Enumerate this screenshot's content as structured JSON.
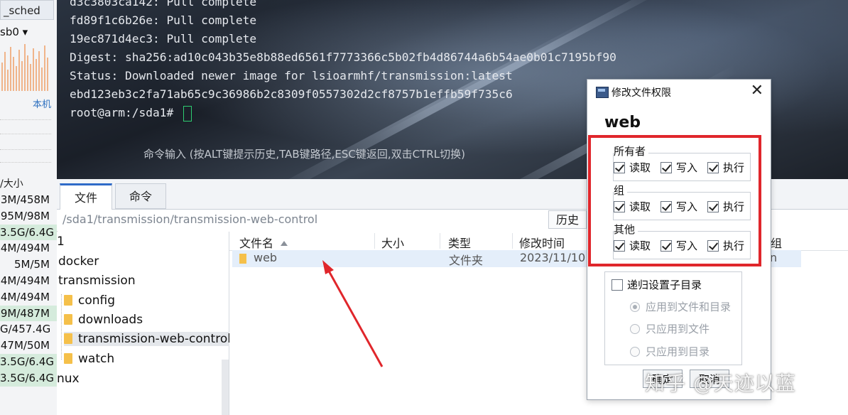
{
  "left_panel": {
    "sched_label": "_sched",
    "iface": "sb0",
    "local_label": "本机",
    "size_header": "/大小",
    "sizes": [
      "3M/458M",
      "95M/98M",
      "3.5G/6.4G",
      "4M/494M",
      "5M/5M",
      "4M/494M",
      "4M/494M",
      "9M/487M",
      "G/457.4G",
      "47M/50M",
      "3.5G/6.4G",
      "3.5G/6.4G"
    ]
  },
  "terminal": {
    "lines": [
      "d3c3803ca142: Pull complete",
      "fd89f1c6b26e: Pull complete",
      "19ec871d4ec3: Pull complete",
      "Digest: sha256:ad10c043b35e8b88ed6561f7773366c5b02fb4d86744a6b54ae0b01c7195bf90",
      "Status: Downloaded newer image for lsioarmhf/transmission:latest",
      "ebd123eb3c2fa71ab65c9c36986b2c8309f0557302d2cf8757b1effb59f735c6",
      "root@arm:/sda1# "
    ],
    "hint": "命令输入 (按ALT键提示历史,TAB键路径,ESC键返回,双击CTRL切换)"
  },
  "tabs": {
    "files": "文件",
    "commands": "命令"
  },
  "path": {
    "value": "/sda1/transmission/transmission-web-control",
    "history_button": "历史"
  },
  "tree": {
    "nodes": [
      "1",
      "docker",
      "transmission",
      "config",
      "downloads",
      "transmission-web-control",
      "watch",
      "nux"
    ]
  },
  "file_list": {
    "columns": {
      "name": "文件名",
      "size": "大小",
      "type": "类型",
      "modified": "修改时间",
      "group": "组"
    },
    "rows": [
      {
        "name": "web",
        "type": "文件夹",
        "modified": "2023/11/10",
        "tail": "n"
      }
    ]
  },
  "dialog": {
    "title": "修改文件权限",
    "name": "web",
    "groups": [
      {
        "label": "所有者",
        "read": "读取",
        "write": "写入",
        "exec": "执行",
        "read_checked": true,
        "write_checked": true,
        "exec_checked": true
      },
      {
        "label": "组",
        "read": "读取",
        "write": "写入",
        "exec": "执行",
        "read_checked": true,
        "write_checked": true,
        "exec_checked": true
      },
      {
        "label": "其他",
        "read": "读取",
        "write": "写入",
        "exec": "执行",
        "read_checked": true,
        "write_checked": true,
        "exec_checked": true
      }
    ],
    "recursive_label": "递归设置子目录",
    "recursive_options": [
      "应用到文件和目录",
      "只应用到文件",
      "只应用到目录"
    ],
    "ok_button": "确定",
    "cancel_button": "取消"
  },
  "watermark": "知乎 @天迹以蓝",
  "colors": {
    "highlight_red": "#e0262b",
    "accent_blue": "#2f6bc8",
    "folder_yellow": "#f5c04a"
  }
}
